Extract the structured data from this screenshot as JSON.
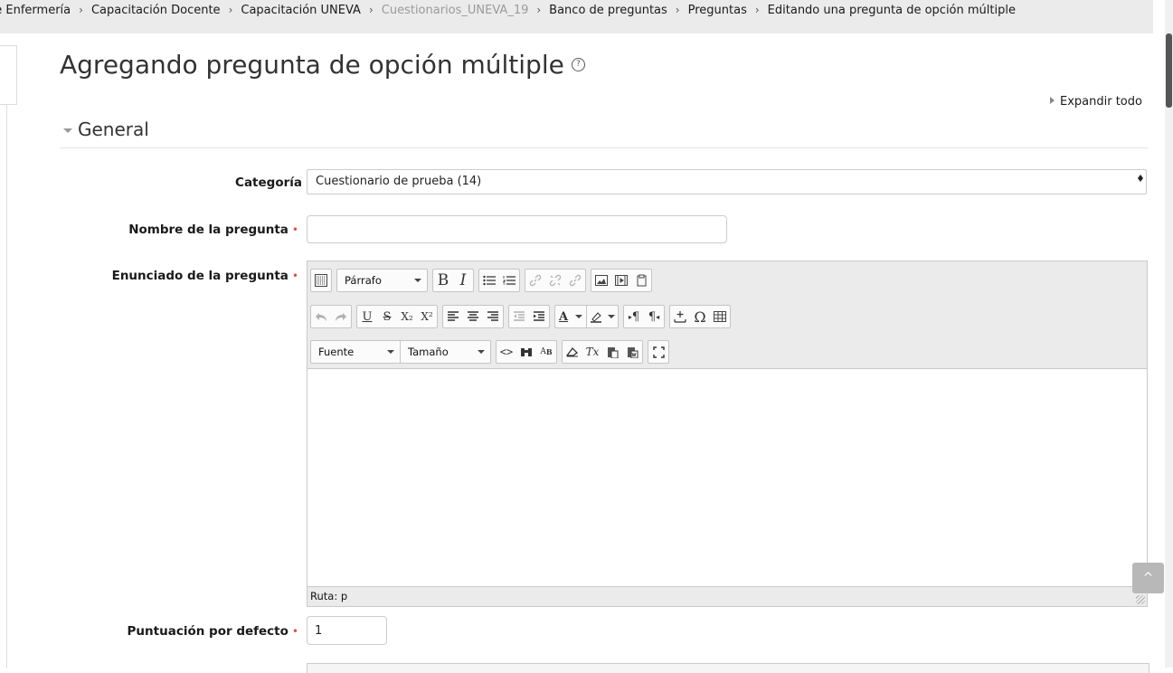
{
  "breadcrumb": [
    {
      "label": "de Enfermería",
      "dim": false
    },
    {
      "label": "Capacitación Docente",
      "dim": false
    },
    {
      "label": "Capacitación UNEVA",
      "dim": false
    },
    {
      "label": "Cuestionarios_UNEVA_19",
      "dim": true
    },
    {
      "label": "Banco de preguntas",
      "dim": false
    },
    {
      "label": "Preguntas",
      "dim": false
    },
    {
      "label": "Editando una pregunta de opción múltiple",
      "dim": false
    }
  ],
  "page": {
    "title": "Agregando pregunta de opción múltiple",
    "help_glyph": "?",
    "expand_all": "Expandir todo"
  },
  "section": {
    "title": "General"
  },
  "form": {
    "category": {
      "label": "Categoría",
      "value": "Cuestionario de prueba (14)"
    },
    "name": {
      "label": "Nombre de la pregunta",
      "value": "",
      "required_mark": "•"
    },
    "statement": {
      "label": "Enunciado de la pregunta",
      "required_mark": "•"
    },
    "points": {
      "label": "Puntuación por defecto",
      "value": "1",
      "required_mark": "•"
    }
  },
  "editor": {
    "paragraph_format": "Párrafo",
    "font": "Fuente",
    "size": "Tamaño",
    "path": "Ruta: p",
    "glyphs": {
      "bold": "B",
      "italic": "I",
      "underline": "U",
      "strike": "S",
      "sub": "X₂",
      "sup": "X²",
      "pilcrow": "¶",
      "omega": "Ω",
      "tx": "Tx",
      "code": "<>"
    }
  },
  "scroll_top_glyph": "^"
}
